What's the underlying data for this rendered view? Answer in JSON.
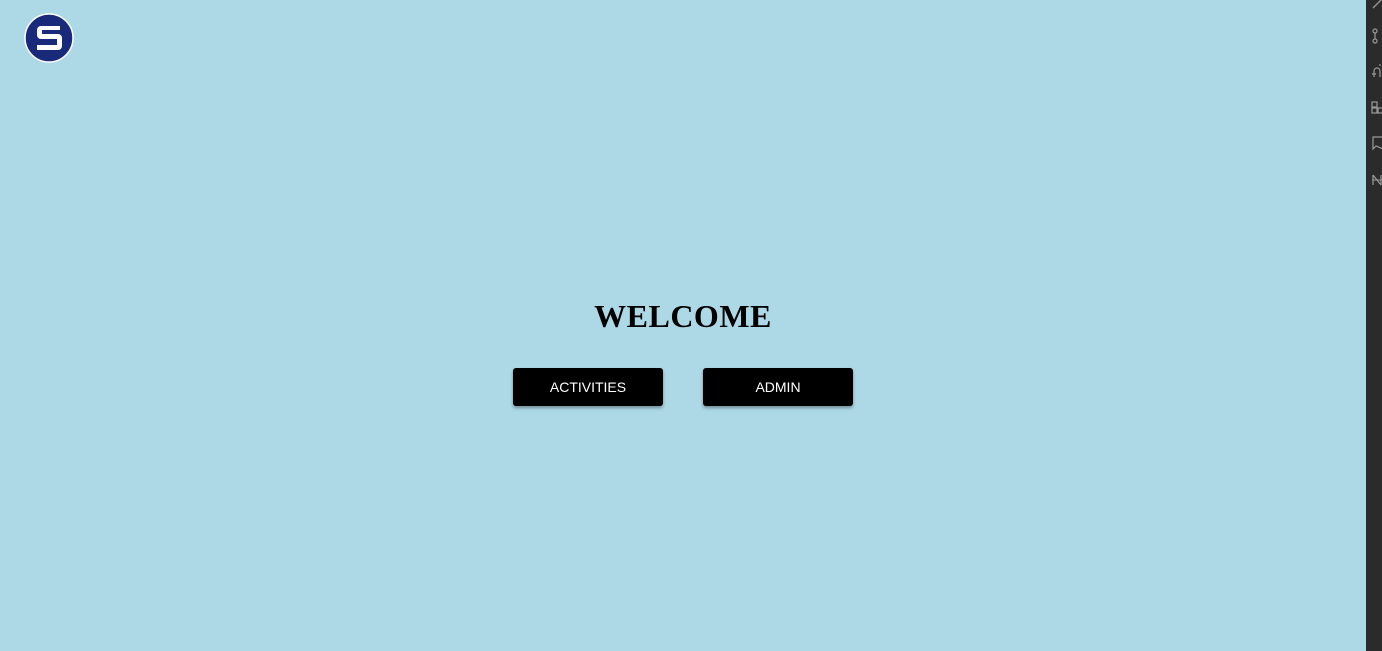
{
  "logo": {
    "icon": "s-circle-logo-icon",
    "color": "#1a2a7a"
  },
  "main": {
    "title": "WELCOME",
    "buttons": {
      "activities": "ACTIVITIES",
      "admin": "ADMIN"
    }
  },
  "side_rail": {
    "icons": [
      "edit-icon",
      "source-control-icon",
      "debug-icon",
      "extensions-icon",
      "bookmark-icon",
      "no-symbol-icon"
    ]
  },
  "colors": {
    "background": "#add8e6",
    "button": "#000000",
    "button_text": "#ffffff",
    "rail": "#2b2b2b"
  }
}
